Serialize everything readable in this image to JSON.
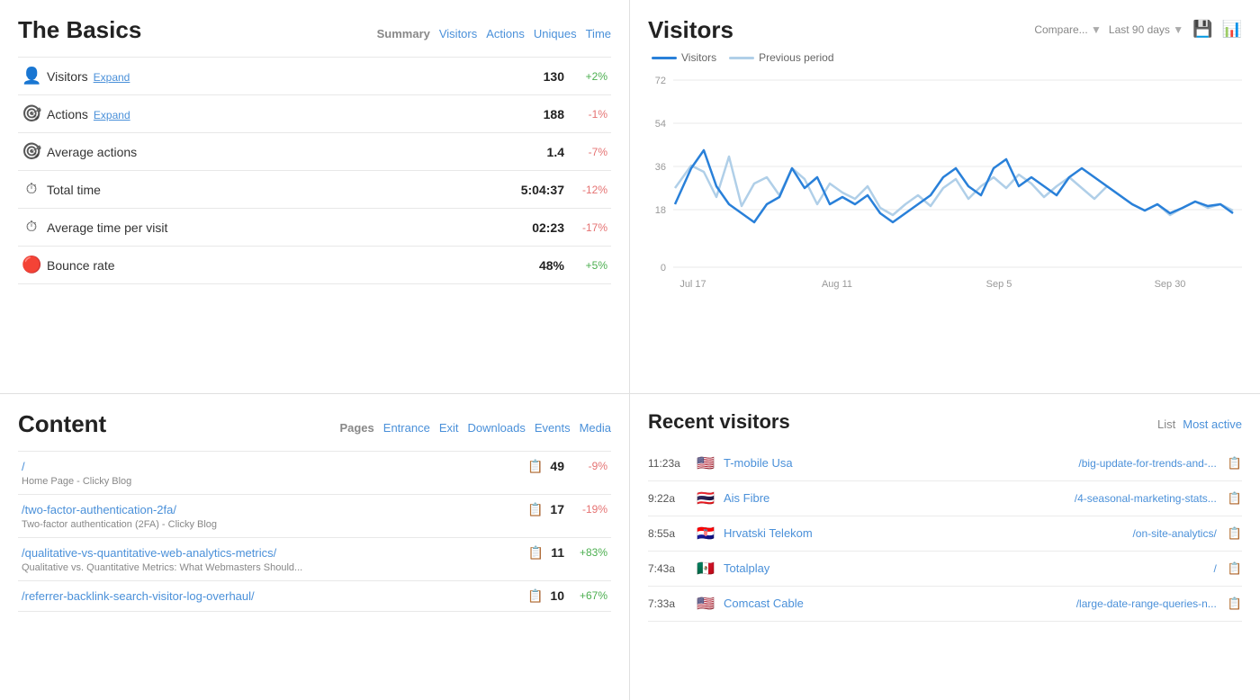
{
  "basics": {
    "title": "The Basics",
    "nav": {
      "summary": "Summary",
      "visitors": "Visitors",
      "actions": "Actions",
      "uniques": "Uniques",
      "time": "Time"
    },
    "metrics": [
      {
        "icon": "👤",
        "label": "Visitors",
        "hasExpand": true,
        "expandLabel": "Expand",
        "value": "130",
        "change": "+2%",
        "changeType": "positive"
      },
      {
        "icon": "🎯",
        "label": "Actions",
        "hasExpand": true,
        "expandLabel": "Expand",
        "value": "188",
        "change": "-1%",
        "changeType": "negative"
      },
      {
        "icon": "🎯",
        "label": "Average actions",
        "hasExpand": false,
        "value": "1.4",
        "change": "-7%",
        "changeType": "negative"
      },
      {
        "icon": "⏱",
        "label": "Total time",
        "hasExpand": false,
        "value": "5:04:37",
        "change": "-12%",
        "changeType": "negative"
      },
      {
        "icon": "⏱",
        "label": "Average time per visit",
        "hasExpand": false,
        "value": "02:23",
        "change": "-17%",
        "changeType": "negative"
      },
      {
        "icon": "🔴",
        "label": "Bounce rate",
        "hasExpand": false,
        "value": "48%",
        "change": "+5%",
        "changeType": "positive"
      }
    ]
  },
  "content": {
    "title": "Content",
    "nav": {
      "pages": "Pages",
      "entrance": "Entrance",
      "exit": "Exit",
      "downloads": "Downloads",
      "events": "Events",
      "media": "Media"
    },
    "items": [
      {
        "url": "/",
        "subtitle": "Home Page - Clicky Blog",
        "count": "49",
        "change": "-9%",
        "changeType": "negative"
      },
      {
        "url": "/two-factor-authentication-2fa/",
        "subtitle": "Two-factor authentication (2FA) - Clicky Blog",
        "count": "17",
        "change": "-19%",
        "changeType": "negative"
      },
      {
        "url": "/qualitative-vs-quantitative-web-analytics-metrics/",
        "subtitle": "Qualitative vs. Quantitative Metrics: What Webmasters Should...",
        "count": "11",
        "change": "+83%",
        "changeType": "positive"
      },
      {
        "url": "/referrer-backlink-search-visitor-log-overhaul/",
        "subtitle": "",
        "count": "10",
        "change": "+67%",
        "changeType": "positive"
      }
    ]
  },
  "visitors_chart": {
    "title": "Visitors",
    "compare_label": "Compare...",
    "period_label": "Last 90 days",
    "legend": {
      "visitors": "Visitors",
      "previous": "Previous period"
    },
    "y_labels": [
      "72",
      "54",
      "36",
      "18",
      "0"
    ],
    "x_labels": [
      "Jul 17",
      "Aug 11",
      "Sep 5",
      "Sep 30"
    ]
  },
  "recent_visitors": {
    "title": "Recent visitors",
    "nav": {
      "list": "List",
      "most_active": "Most active"
    },
    "visitors": [
      {
        "time": "11:23a",
        "flag": "🇺🇸",
        "isp": "T-mobile Usa",
        "page": "/big-update-for-trends-and-...",
        "copy": "📋"
      },
      {
        "time": "9:22a",
        "flag": "🇹🇭",
        "isp": "Ais Fibre",
        "page": "/4-seasonal-marketing-stats...",
        "copy": "📋"
      },
      {
        "time": "8:55a",
        "flag": "🇭🇷",
        "isp": "Hrvatski Telekom",
        "page": "/on-site-analytics/",
        "copy": "📋"
      },
      {
        "time": "7:43a",
        "flag": "🇲🇽",
        "isp": "Totalplay",
        "page": "/",
        "copy": "📋"
      },
      {
        "time": "7:33a",
        "flag": "🇺🇸",
        "isp": "Comcast Cable",
        "page": "/large-date-range-queries-n...",
        "copy": "📋"
      }
    ]
  }
}
